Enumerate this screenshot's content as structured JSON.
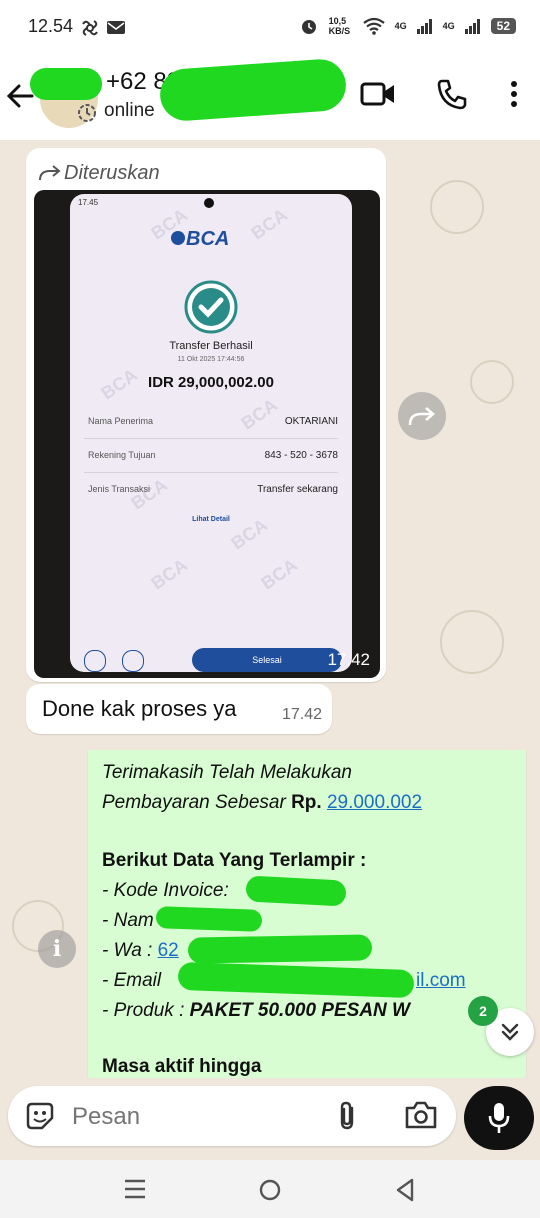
{
  "status_bar": {
    "time": "12.54",
    "net_speed": "10,5 KB/S",
    "signal1": "4G",
    "signal2": "4G",
    "battery": "52"
  },
  "header": {
    "contact": "+62 822",
    "status": "online"
  },
  "forwarded_message": {
    "forwarded_label": "Diteruskan",
    "time": "17.42",
    "receipt": {
      "phone_time": "17.45",
      "bank": "BCA",
      "title": "Transfer Berhasil",
      "datetime": "11 Okt 2025 17:44:56",
      "amount": "IDR 29,000,002.00",
      "rows": [
        {
          "label": "Nama Penerima",
          "value": "OKTARIANI"
        },
        {
          "label": "Rekening Tujuan",
          "value": "843 - 520 - 3678"
        },
        {
          "label": "Jenis Transaksi",
          "value": "Transfer sekarang"
        }
      ],
      "detail_link": "Lihat Detail",
      "done_button": "Selesai"
    }
  },
  "text_message": {
    "text": "Done kak proses ya",
    "time": "17.42"
  },
  "outgoing_message": {
    "line1": "Terimakasih Telah Melakukan",
    "line2_prefix": "Pembayaran Sebesar",
    "line2_bold": "Rp.",
    "amount_link": "29.000.002",
    "heading": "Berikut Data Yang Terlampir :",
    "item_invoice": "- Kode Invoice:",
    "item_name": "- Nam",
    "item_wa": "- Wa : ",
    "wa_link": "62",
    "item_email": "- Email",
    "email_link": "il.com",
    "item_product_prefix": "- Produk : ",
    "item_product_bold": "PAKET 50.000 PESAN W",
    "footer": "Masa aktif hingga"
  },
  "scroll_badge": "2",
  "input": {
    "placeholder": "Pesan"
  },
  "colors": {
    "accent_green": "#25a244",
    "out_bubble": "#d9fdd3",
    "redaction": "#20d820"
  }
}
